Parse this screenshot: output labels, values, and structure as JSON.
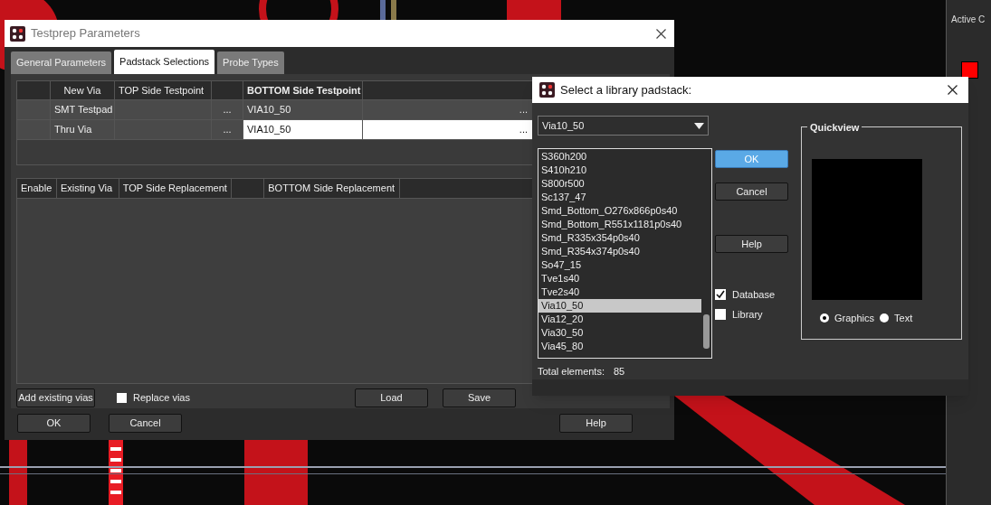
{
  "main_dialog": {
    "title": "Testprep Parameters",
    "tabs": [
      {
        "label": "General Parameters",
        "selected": false
      },
      {
        "label": "Padstack Selections",
        "selected": true
      },
      {
        "label": "Probe Types",
        "selected": false
      }
    ],
    "via_table": {
      "columns": [
        "New Via",
        "TOP Side Testpoint",
        "BOTTOM Side Testpoint"
      ],
      "rows": [
        {
          "new_via": "SMT Testpad",
          "top_browse": "...",
          "bottom": "VIA10_50",
          "bottom_browse": "...",
          "editing": false
        },
        {
          "new_via": "Thru Via",
          "top_browse": "...",
          "bottom": "VIA10_50",
          "bottom_browse": "...",
          "editing": true
        }
      ]
    },
    "replacement_table": {
      "columns": [
        "Enable",
        "Existing Via",
        "TOP Side Replacement",
        "BOTTOM Side Replacement"
      ]
    },
    "add_button": "Add existing vias",
    "replace_vias": {
      "label": "Replace vias",
      "checked": false
    },
    "load_button": "Load",
    "save_button": "Save",
    "ok_button": "OK",
    "cancel_button": "Cancel",
    "help_button": "Help"
  },
  "padstack_dialog": {
    "title": "Select a library padstack:",
    "dropdown": "Via10_50",
    "items": [
      {
        "label": "S360h200",
        "selected": false
      },
      {
        "label": "S410h210",
        "selected": false
      },
      {
        "label": "S800r500",
        "selected": false
      },
      {
        "label": "Sc137_47",
        "selected": false
      },
      {
        "label": "Smd_Bottom_O276x866p0s40",
        "selected": false
      },
      {
        "label": "Smd_Bottom_R551x1181p0s40",
        "selected": false
      },
      {
        "label": "Smd_R335x354p0s40",
        "selected": false
      },
      {
        "label": "Smd_R354x374p0s40",
        "selected": false
      },
      {
        "label": "So47_15",
        "selected": false
      },
      {
        "label": "Tve1s40",
        "selected": false
      },
      {
        "label": "Tve2s40",
        "selected": false
      },
      {
        "label": "Via10_50",
        "selected": true
      },
      {
        "label": "Via12_20",
        "selected": false
      },
      {
        "label": "Via30_50",
        "selected": false
      },
      {
        "label": "Via45_80",
        "selected": false
      }
    ],
    "buttons": [
      {
        "label": "OK",
        "default": true
      },
      {
        "label": "Cancel",
        "default": false
      },
      {
        "label": "Help",
        "default": false
      }
    ],
    "checkboxes": [
      {
        "label": "Database",
        "checked": true
      },
      {
        "label": "Library",
        "checked": false
      }
    ],
    "quickview": {
      "title": "Quickview",
      "radios": [
        {
          "label": "Graphics",
          "selected": true
        },
        {
          "label": "Text",
          "selected": false
        }
      ]
    },
    "total_label": "Total elements:",
    "total": "85"
  },
  "side_panel": {
    "label": "Active C",
    "color": "#ff0000"
  }
}
